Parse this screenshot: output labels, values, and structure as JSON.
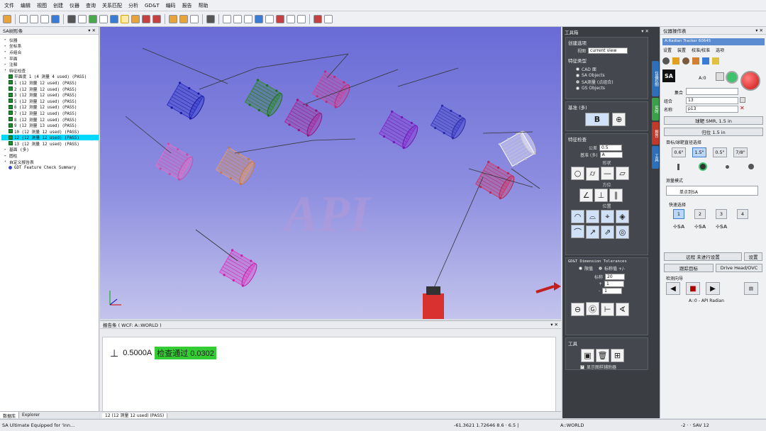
{
  "menu": [
    "文件",
    "编辑",
    "视图",
    "创建",
    "仪器",
    "查询",
    "关系匹配",
    "分析",
    "GD&T",
    "编码",
    "报告",
    "帮助"
  ],
  "tree": {
    "title": "SA树形条",
    "items": [
      {
        "label": "仪器",
        "level": 1,
        "kind": "folder"
      },
      {
        "label": "坐标系",
        "level": 1,
        "kind": "folder"
      },
      {
        "label": "点组合",
        "level": 1,
        "kind": "folder"
      },
      {
        "label": "平面",
        "level": 1,
        "kind": "folder"
      },
      {
        "label": "注释",
        "level": 1,
        "kind": "folder"
      },
      {
        "label": "特征检查",
        "level": 1,
        "kind": "folder-open"
      },
      {
        "label": "平面度 1 (4 测量 4 used) (PASS)",
        "level": 2,
        "kind": "check"
      },
      {
        "label": "1 (12 测量 12 used) (PASS)",
        "level": 2,
        "kind": "check"
      },
      {
        "label": "2 (12 测量 12 used) (PASS)",
        "level": 2,
        "kind": "check"
      },
      {
        "label": "3 (12 测量 12 used) (PASS)",
        "level": 2,
        "kind": "check"
      },
      {
        "label": "5 (12 测量 12 used) (PASS)",
        "level": 2,
        "kind": "check"
      },
      {
        "label": "6 (12 测量 12 used) (PASS)",
        "level": 2,
        "kind": "check"
      },
      {
        "label": "7 (12 测量 12 used) (PASS)",
        "level": 2,
        "kind": "check"
      },
      {
        "label": "8 (12 测量 12 used) (PASS)",
        "level": 2,
        "kind": "check"
      },
      {
        "label": "9 (12 测量 13 used) (PASS)",
        "level": 2,
        "kind": "check"
      },
      {
        "label": "10 (12 测量 12 used) (PASS)",
        "level": 2,
        "kind": "check"
      },
      {
        "label": "12 (12 测量 12 used) (PASS)",
        "level": 2,
        "kind": "check",
        "selected": true
      },
      {
        "label": "13 (12 测量 12 used) (PASS)",
        "level": 2,
        "kind": "check"
      },
      {
        "label": "基面 (多)",
        "level": 1,
        "kind": "folder"
      },
      {
        "label": "圆柱",
        "level": 1,
        "kind": "folder"
      },
      {
        "label": "自定义报告表",
        "level": 1,
        "kind": "folder-open"
      },
      {
        "label": "GDT Feature Check Summary",
        "level": 2,
        "kind": "report"
      }
    ],
    "tabs": [
      "数据库",
      "Explorer"
    ]
  },
  "viewport": {
    "watermark": "API"
  },
  "report": {
    "title": "报告条 ( WCF: A::WORLD )",
    "symbol": "⊥",
    "tolerance": "0.5000",
    "datum": "A",
    "result": "检查通过 0.0302",
    "tab": "12 (12 测量 12 used) (PASS)"
  },
  "status": {
    "left": "SA Ultimate Equipped for 'inn...",
    "coords": "-61.3621 1.72646 8.6 · 6.5 |",
    "frame": "A::WORLD",
    "right": "-2 · ·   SAV 12"
  },
  "toolbox": {
    "title": "工具箱",
    "create_options_title": "创建选项",
    "view_label": "视图",
    "view_value": "current view",
    "feature_type_title": "特征类型",
    "feature_types": [
      "CAD 面",
      "SA Objects",
      "SA测量 (点组合)",
      "GS Objects"
    ],
    "feature_type_selected": 2,
    "datum_title": "基准 (多)",
    "check_title": "特征检查",
    "tolerance_label": "公差",
    "tolerance_value": "0.5",
    "datum_label": "基准 (多)",
    "datum_value": "A",
    "shape_label": "形状",
    "orient_label": "方位",
    "position_label": "位置",
    "dim_tol_title": "GD&T Dimension Tolerances",
    "dim_radio": [
      "限值",
      "标称值 +/-"
    ],
    "nominal_label": "标称",
    "plus_label": "+",
    "minus_label": "-",
    "nominal_value": "20",
    "plus_value": "1",
    "minus_value": "1",
    "tools_title": "工具",
    "show_label": "显示图样辅助器"
  },
  "vtabs": [
    "仪器控制",
    "实时",
    "报告",
    "工具"
  ],
  "instrument": {
    "title": "仪器操作表",
    "tracker": "A:Radian Tracker 60645",
    "menu": [
      "设置",
      "装置",
      "校准/校准",
      "选项"
    ],
    "status_text": "A:0",
    "group_label": "集合",
    "group_value": "",
    "collect_label": "组合",
    "collect_value": "13",
    "name_label": "名称",
    "name_value": "p13",
    "target_btn1": "球靶 SMR, 1.5 in",
    "target_btn2": "归位 1.5 in",
    "target_title": "目标/球靶直径选择",
    "sizes": [
      "0.6\"",
      "1.5\"",
      "0.5\"",
      "7/8\""
    ],
    "size_selected": 1,
    "mode_title": "测量模式",
    "mode_value": "单点到SA",
    "quick_title": "快速选择",
    "quick": [
      "1",
      "2",
      "3",
      "4"
    ],
    "remote_btn": "远程 未进行设置",
    "settings_btn": "设置",
    "track_btn": "跟踪目标",
    "drive_btn": "Drive Head/OVC",
    "guide_title": "检测向导",
    "bottom": "A::0 - API Radian"
  },
  "colors": {
    "accent": "#00d9ff",
    "pass": "#33cc33"
  }
}
